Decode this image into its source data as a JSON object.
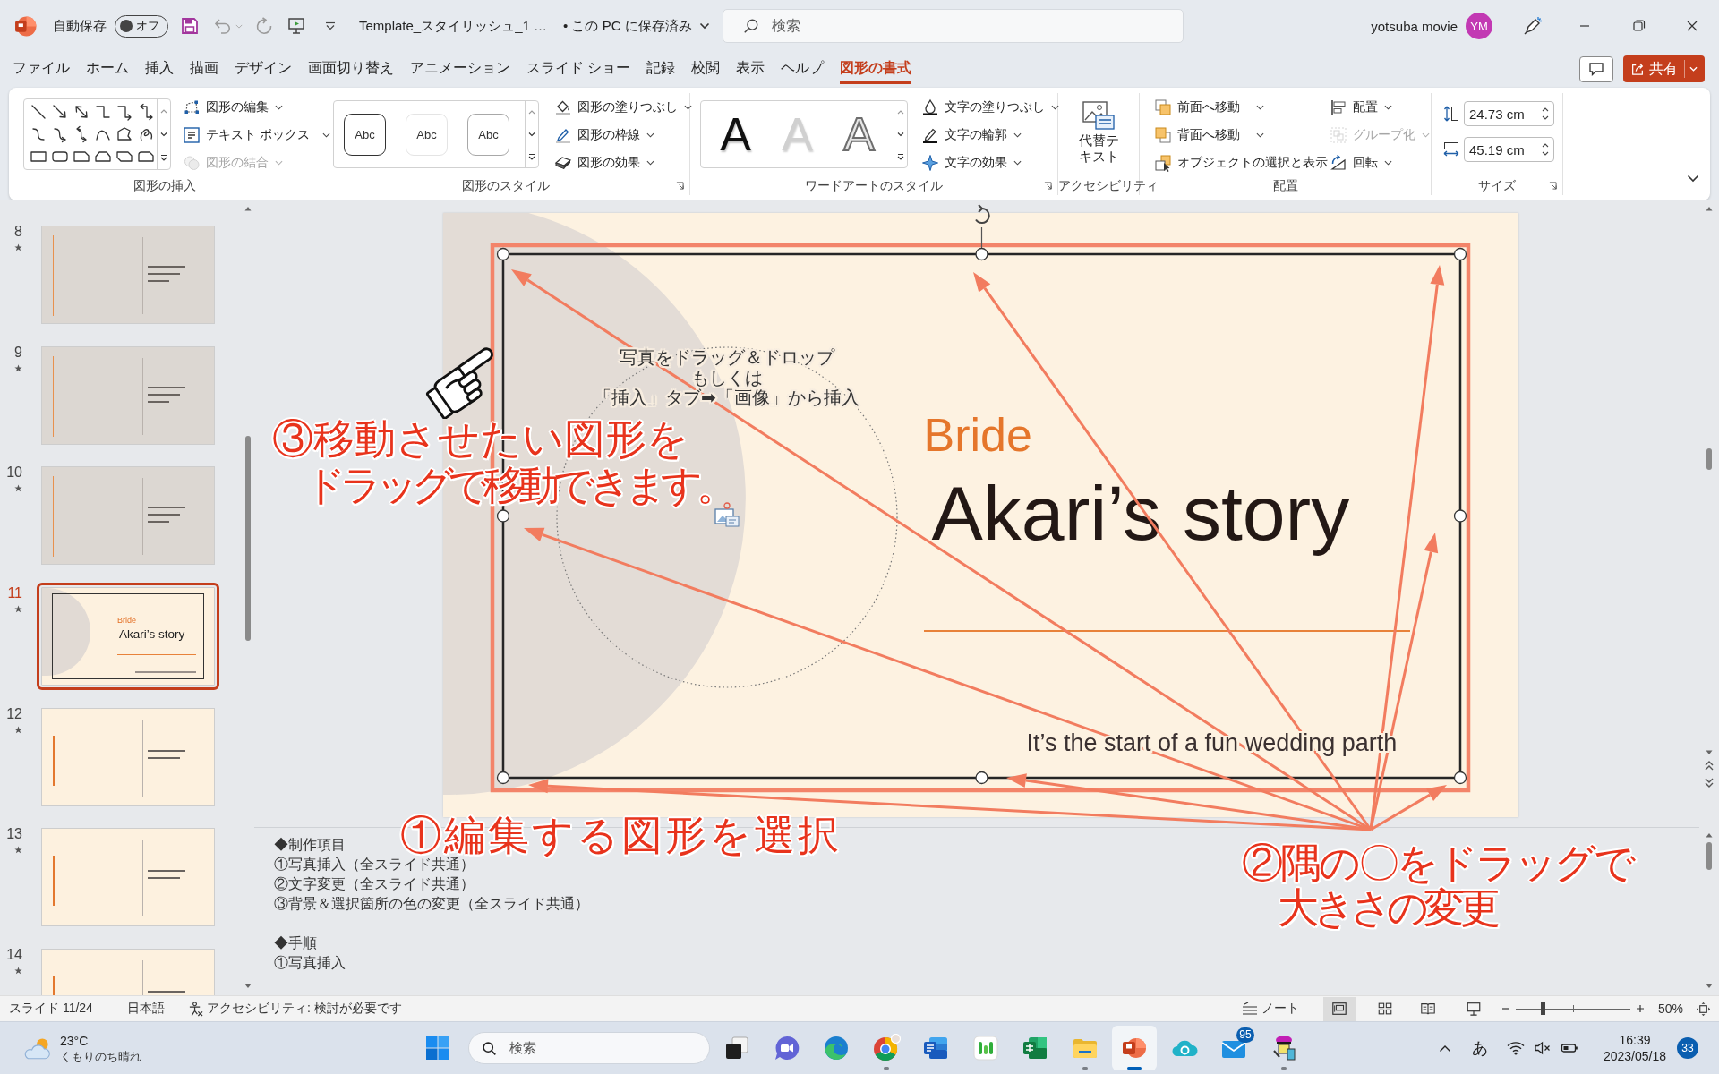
{
  "title_bar": {
    "autosave_label": "自動保存",
    "autosave_toggle": {
      "label": "オフ",
      "on": false
    },
    "document_title": "Template_スタイリッシュ_1 …",
    "save_status": "• この PC に保存済み",
    "search": {
      "placeholder": "検索"
    },
    "user_name": "yotsuba movie",
    "avatar_initials": "YM"
  },
  "tabs": [
    {
      "label": "ファイル",
      "selected": false
    },
    {
      "label": "ホーム",
      "selected": false
    },
    {
      "label": "挿入",
      "selected": false
    },
    {
      "label": "描画",
      "selected": false
    },
    {
      "label": "デザイン",
      "selected": false
    },
    {
      "label": "画面切り替え",
      "selected": false
    },
    {
      "label": "アニメーション",
      "selected": false
    },
    {
      "label": "スライド ショー",
      "selected": false
    },
    {
      "label": "記録",
      "selected": false
    },
    {
      "label": "校閲",
      "selected": false
    },
    {
      "label": "表示",
      "selected": false
    },
    {
      "label": "ヘルプ",
      "selected": false
    },
    {
      "label": "図形の書式",
      "selected": true
    }
  ],
  "share_button": {
    "label": "共有"
  },
  "ribbon": {
    "insert_shapes": {
      "label": "図形の挿入",
      "buttons": [
        {
          "label": "図形の編集",
          "dropdown": true,
          "disabled": false
        },
        {
          "label": "テキスト ボックス",
          "dropdown": true,
          "disabled": false
        },
        {
          "label": "図形の結合",
          "dropdown": true,
          "disabled": true
        }
      ]
    },
    "shape_styles": {
      "label": "図形のスタイル",
      "presets": [
        {
          "label": "Abc",
          "kind": "dark"
        },
        {
          "label": "Abc",
          "kind": "faint"
        },
        {
          "label": "Abc",
          "kind": "grey"
        }
      ],
      "buttons": [
        {
          "label": "図形の塗りつぶし",
          "dropdown": true
        },
        {
          "label": "図形の枠線",
          "dropdown": true
        },
        {
          "label": "図形の効果",
          "dropdown": true
        }
      ]
    },
    "wordart_styles": {
      "label": "ワードアートのスタイル",
      "presets": [
        {
          "label": "A",
          "kind": "solid"
        },
        {
          "label": "A",
          "kind": "faint"
        },
        {
          "label": "A",
          "kind": "outline"
        }
      ],
      "buttons": [
        {
          "label": "文字の塗りつぶし",
          "dropdown": true
        },
        {
          "label": "文字の輪郭",
          "dropdown": true
        },
        {
          "label": "文字の効果",
          "dropdown": true
        }
      ]
    },
    "accessibility": {
      "label": "アクセシビリティ",
      "button": "代替テキスト"
    },
    "arrange": {
      "label": "配置",
      "buttons": [
        {
          "label": "前面へ移動",
          "dropdown": true,
          "disabled": false
        },
        {
          "label": "背面へ移動",
          "dropdown": true,
          "disabled": false
        },
        {
          "label": "オブジェクトの選択と表示",
          "dropdown": false,
          "disabled": false
        },
        {
          "label": "配置",
          "dropdown": true,
          "disabled": false
        },
        {
          "label": "グループ化",
          "dropdown": true,
          "disabled": true
        },
        {
          "label": "回転",
          "dropdown": true,
          "disabled": false
        }
      ]
    },
    "size": {
      "label": "サイズ",
      "height": "24.73 cm",
      "width": "45.19 cm"
    }
  },
  "slides": [
    {
      "number": "8",
      "kind": "grey",
      "selected": false
    },
    {
      "number": "9",
      "kind": "grey",
      "selected": false
    },
    {
      "number": "10",
      "kind": "grey",
      "selected": false
    },
    {
      "number": "11",
      "kind": "title",
      "selected": true,
      "label": "Bride",
      "title": "Akari’s story"
    },
    {
      "number": "12",
      "kind": "cream",
      "selected": false
    },
    {
      "number": "13",
      "kind": "cream",
      "selected": false
    },
    {
      "number": "14",
      "kind": "cream",
      "selected": false
    }
  ],
  "slide": {
    "placeholder_lines": [
      "写真をドラッグ＆ドロップ",
      "もしくは",
      "「挿入」タブ➡「画像」から挿入"
    ],
    "label": "Bride",
    "title": "Akari’s story",
    "caption": "It’s the start of a fun wedding parth"
  },
  "annotations": [
    {
      "kind": "move",
      "lines": [
        "③移動させたい図形を",
        "ドラッグで移動できます。"
      ]
    },
    {
      "kind": "select",
      "lines": [
        "①編集する図形を選択"
      ]
    },
    {
      "kind": "resize",
      "lines": [
        "②隅の〇をドラッグで",
        "大きさの変更"
      ]
    }
  ],
  "notes": {
    "paragraphs": [
      [
        "◆制作項目",
        "①写真挿入（全スライド共通）",
        "②文字変更（全スライド共通）",
        "③背景＆選択箇所の色の変更（全スライド共通）"
      ],
      [
        "◆手順",
        "①写真挿入"
      ]
    ]
  },
  "status_bar": {
    "slide_position": "スライド 11/24",
    "language": "日本語",
    "accessibility": "アクセシビリティ: 検討が必要です",
    "notes_button": "ノート",
    "views": [
      {
        "selected": true
      },
      {
        "selected": false
      },
      {
        "selected": false
      },
      {
        "selected": false
      }
    ],
    "zoom": {
      "level": 0.24,
      "reading": "50%"
    }
  },
  "taskbar": {
    "weather": {
      "temperature": "23°C",
      "condition": "くもりのち晴れ"
    },
    "search": {
      "placeholder": "検索"
    },
    "apps": [
      {
        "running": false,
        "active": false
      },
      {
        "running": false,
        "active": false
      },
      {
        "running": false,
        "active": false
      },
      {
        "running": true,
        "active": false
      },
      {
        "running": false,
        "active": false
      },
      {
        "running": false,
        "active": false
      },
      {
        "running": false,
        "active": false
      },
      {
        "running": true,
        "active": false
      },
      {
        "running": true,
        "active": true
      },
      {
        "running": false,
        "active": false
      },
      {
        "running": false,
        "active": false,
        "badge": "95"
      },
      {
        "running": true,
        "active": false
      }
    ],
    "tray": {
      "input_mode": "あ",
      "time": "16:39",
      "date": "2023/05/18",
      "notification_count": "33"
    }
  }
}
